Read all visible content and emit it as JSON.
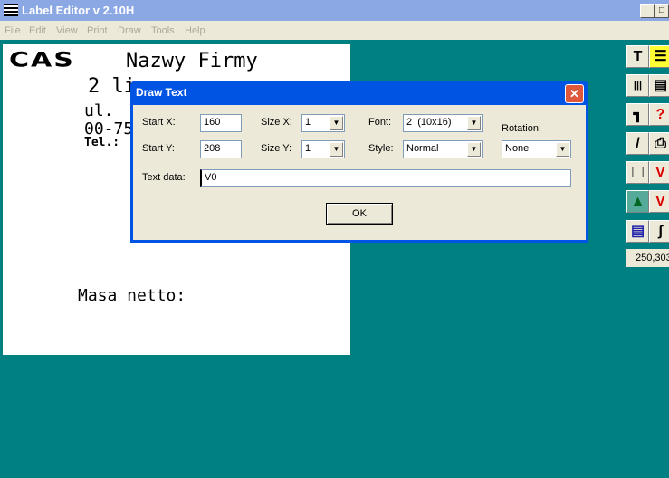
{
  "window": {
    "title": "Label Editor v 2.10H",
    "minimize": "_",
    "maximize": "□"
  },
  "menu": [
    "File",
    "Edit",
    "View",
    "Print",
    "Draw",
    "Tools",
    "Help"
  ],
  "label": {
    "logo": "CAS",
    "line1": "Nazwy Firmy",
    "line2": "2 li",
    "line3": "ul.",
    "line4": "00-75",
    "line5": "Tel.:",
    "line6": "Masa netto:"
  },
  "toolbar": {
    "tools": [
      {
        "icon": "text-icon",
        "glyph": "T"
      },
      {
        "icon": "barcode-icon",
        "glyph": "|||"
      },
      {
        "icon": "corner-line-icon",
        "glyph": "┓"
      },
      {
        "icon": "line-icon",
        "glyph": "/"
      },
      {
        "icon": "rectangle-icon",
        "glyph": "□"
      },
      {
        "icon": "image-icon",
        "glyph": "▲"
      },
      {
        "icon": "layout-icon",
        "glyph": "▤"
      }
    ],
    "tools2": [
      {
        "icon": "form-icon",
        "glyph": "☰"
      },
      {
        "icon": "document-icon",
        "glyph": "▤"
      },
      {
        "icon": "print-help-icon",
        "glyph": "?"
      },
      {
        "icon": "printer-icon",
        "glyph": "⎙"
      },
      {
        "icon": "variable-icon",
        "glyph": "V"
      },
      {
        "icon": "variable2-icon",
        "glyph": "V"
      },
      {
        "icon": "wrench-icon",
        "glyph": "ʃ"
      }
    ],
    "coords": "250,303"
  },
  "dialog": {
    "title": "Draw Text",
    "close": "✕",
    "start_x_label": "Start X:",
    "start_x": "160",
    "start_y_label": "Start Y:",
    "start_y": "208",
    "size_x_label": "Size X:",
    "size_x": "1",
    "size_y_label": "Size Y:",
    "size_y": "1",
    "font_label": "Font:",
    "font": "2  (10x16)",
    "style_label": "Style:",
    "style": "Normal",
    "rotation_label": "Rotation:",
    "rotation": "None",
    "text_data_label": "Text data:",
    "text_data": "V0",
    "ok": "OK"
  }
}
